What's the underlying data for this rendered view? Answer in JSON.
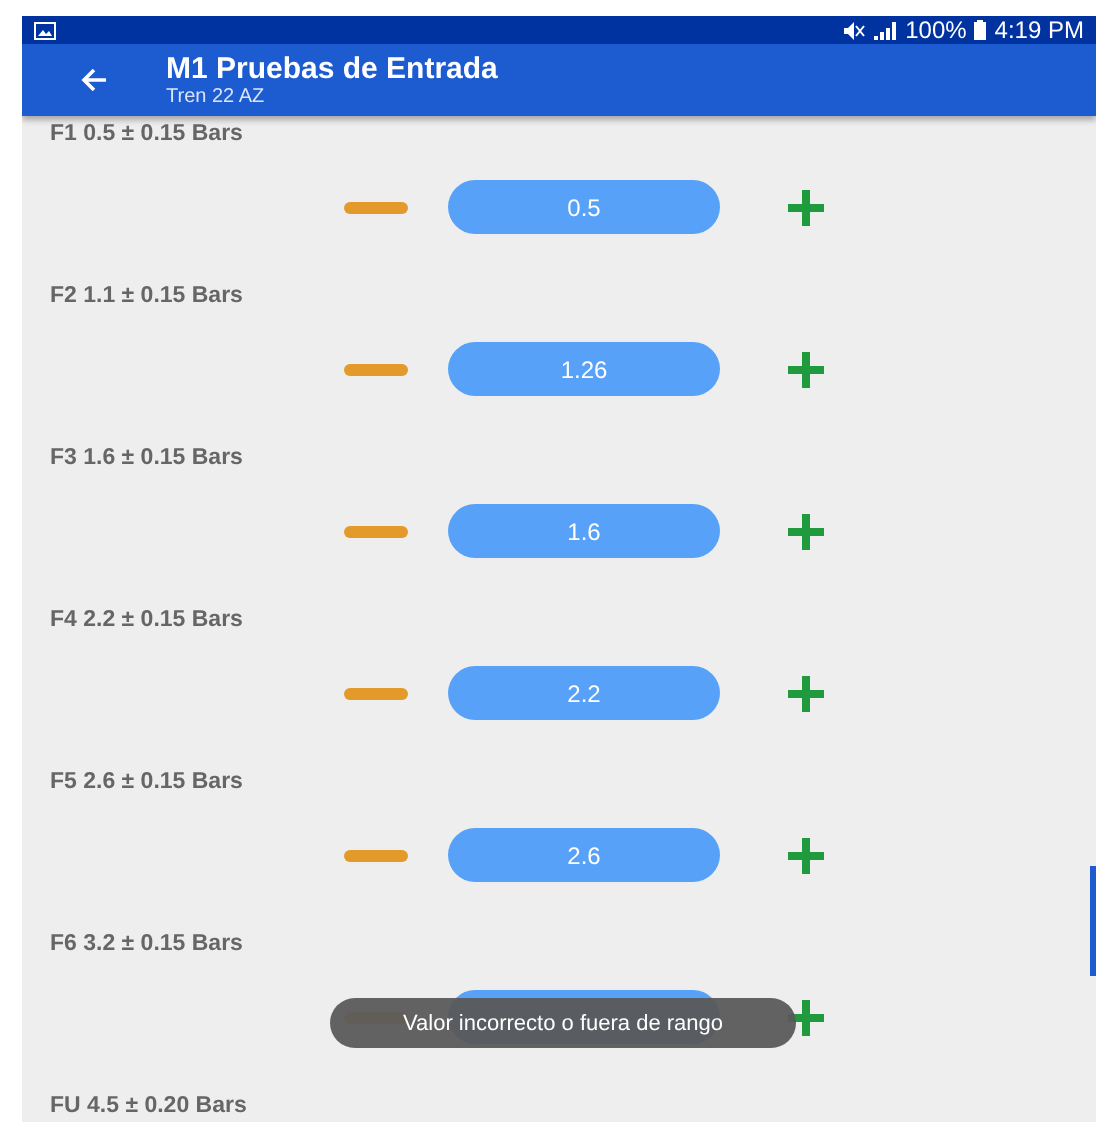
{
  "status_bar": {
    "battery": "100%",
    "time": "4:19 PM"
  },
  "app_bar": {
    "title": "M1 Pruebas de Entrada",
    "subtitle": "Tren 22 AZ"
  },
  "items": [
    {
      "label": "F1 0.5 ± 0.15 Bars",
      "value": "0.5"
    },
    {
      "label": "F2 1.1 ± 0.15 Bars",
      "value": "1.26"
    },
    {
      "label": "F3 1.6 ± 0.15 Bars",
      "value": "1.6"
    },
    {
      "label": "F4 2.2 ± 0.15 Bars",
      "value": "2.2"
    },
    {
      "label": "F5 2.6 ± 0.15 Bars",
      "value": "2.6"
    },
    {
      "label": "F6 3.2 ± 0.15 Bars"
    },
    {
      "label": "FU 4.5 ± 0.20 Bars"
    }
  ],
  "toast": "Valor incorrecto o fuera de rango"
}
